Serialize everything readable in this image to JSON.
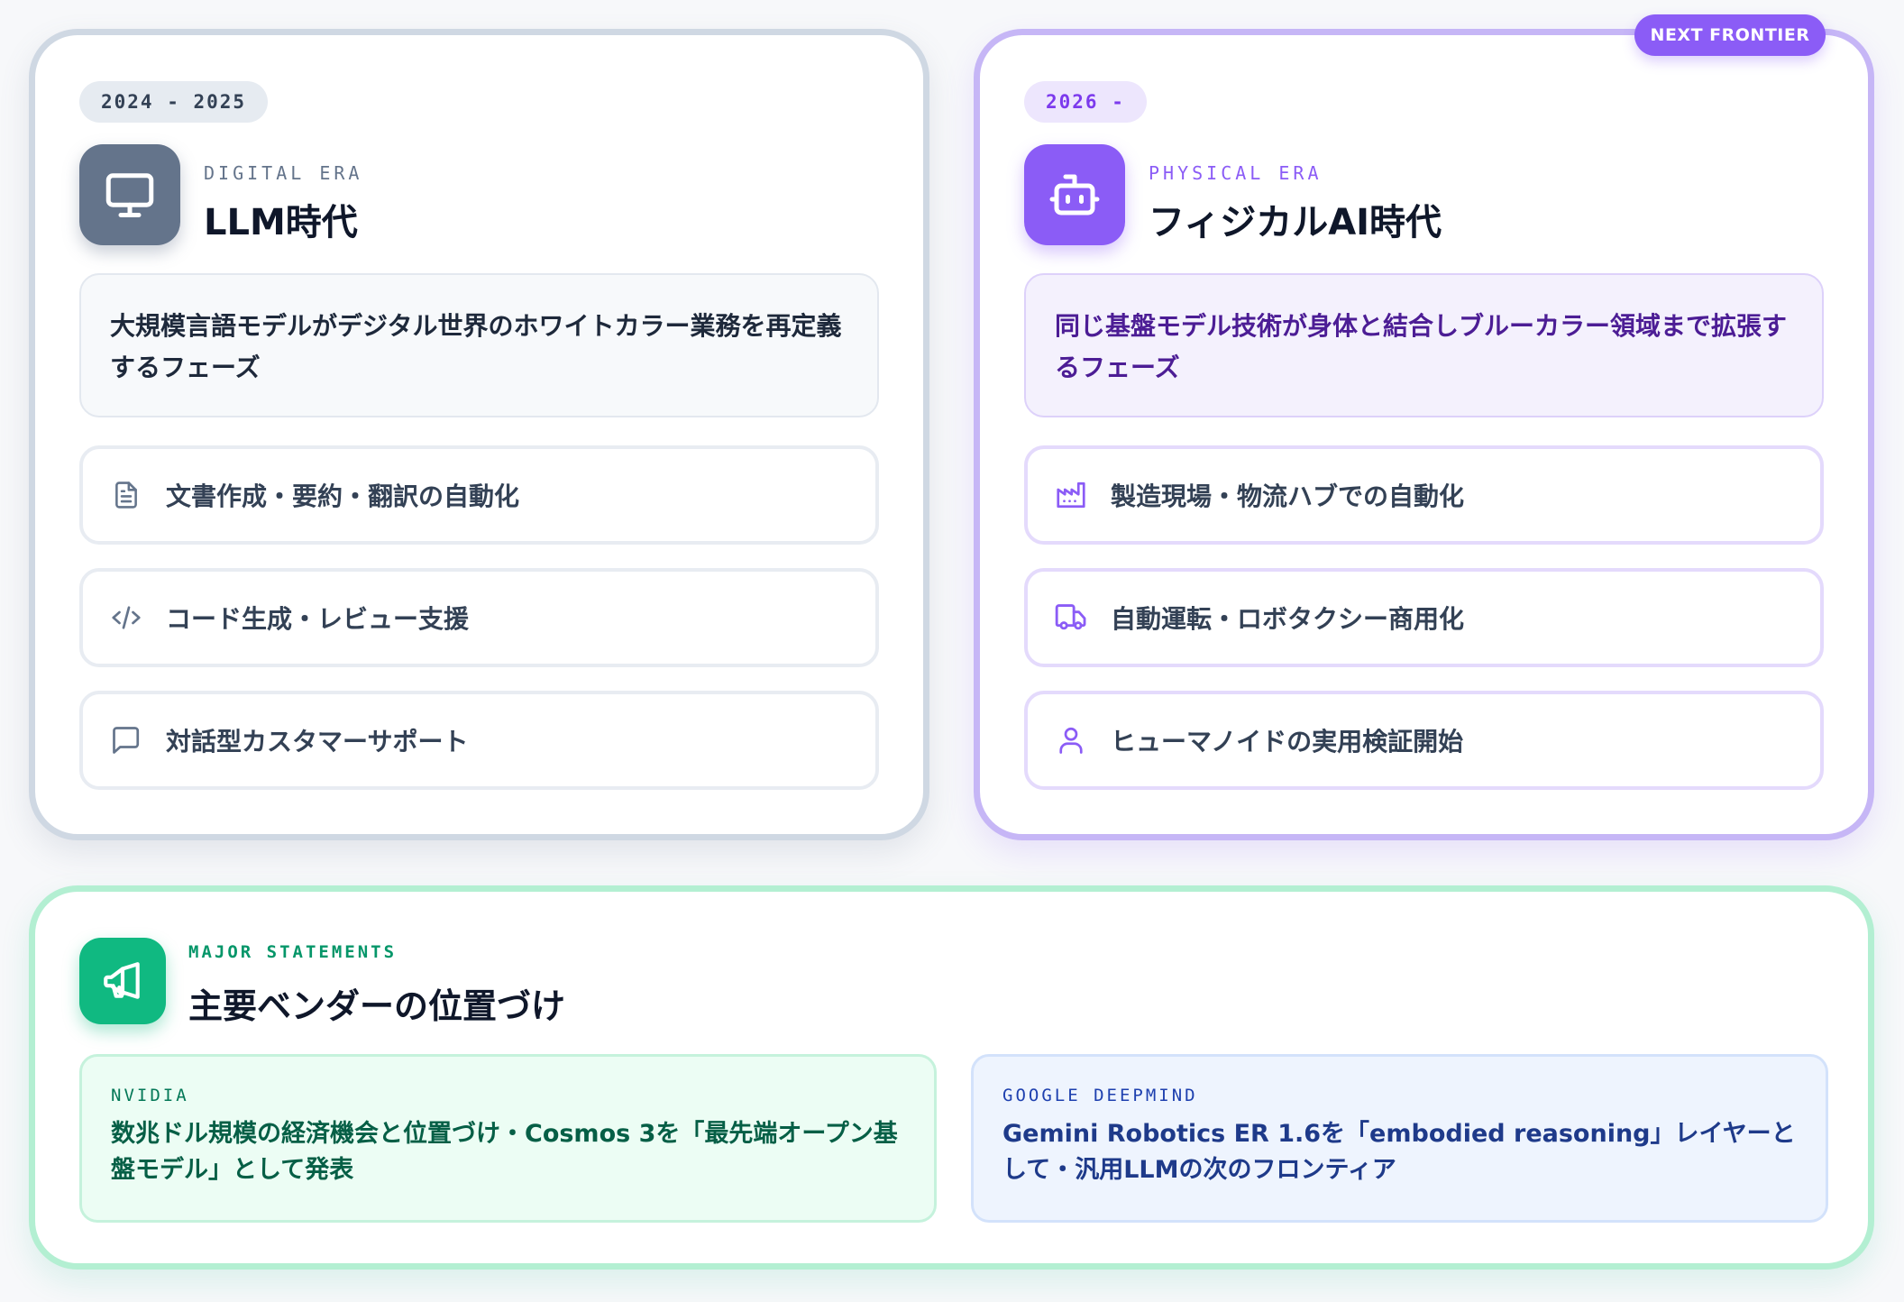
{
  "llm_era": {
    "period": "2024 - 2025",
    "label": "DIGITAL ERA",
    "title": "LLM時代",
    "description": "大規模言語モデルがデジタル世界のホワイトカラー業務を再定義するフェーズ",
    "items": [
      {
        "icon": "document-icon",
        "text": "文書作成・要約・翻訳の自動化"
      },
      {
        "icon": "code-icon",
        "text": "コード生成・レビュー支援"
      },
      {
        "icon": "chat-bubble-icon",
        "text": "対話型カスタマーサポート"
      }
    ],
    "icon": "monitor-icon",
    "accent": "#64748b"
  },
  "physical_era": {
    "badge": "NEXT FRONTIER",
    "period": "2026 -",
    "label": "PHYSICAL ERA",
    "title": "フィジカルAI時代",
    "description": "同じ基盤モデル技術が身体と結合しブルーカラー領域まで拡張するフェーズ",
    "items": [
      {
        "icon": "factory-icon",
        "text": "製造現場・物流ハブでの自動化"
      },
      {
        "icon": "truck-icon",
        "text": "自動運転・ロボタクシー商用化"
      },
      {
        "icon": "person-icon",
        "text": "ヒューマノイドの実用検証開始"
      }
    ],
    "icon": "robot-icon",
    "accent": "#8b5cf6"
  },
  "major_statements": {
    "label": "MAJOR STATEMENTS",
    "title": "主要ベンダーの位置づけ",
    "icon": "megaphone-icon",
    "accent": "#10b981",
    "vendors": [
      {
        "name": "NVIDIA",
        "statement": "数兆ドル規模の経済機会と位置づけ・Cosmos 3を「最先端オープン基盤モデル」として発表"
      },
      {
        "name": "GOOGLE DEEPMIND",
        "statement": "Gemini Robotics ER 1.6を「embodied reasoning」レイヤーとして・汎用LLMの次のフロンティア"
      }
    ]
  }
}
